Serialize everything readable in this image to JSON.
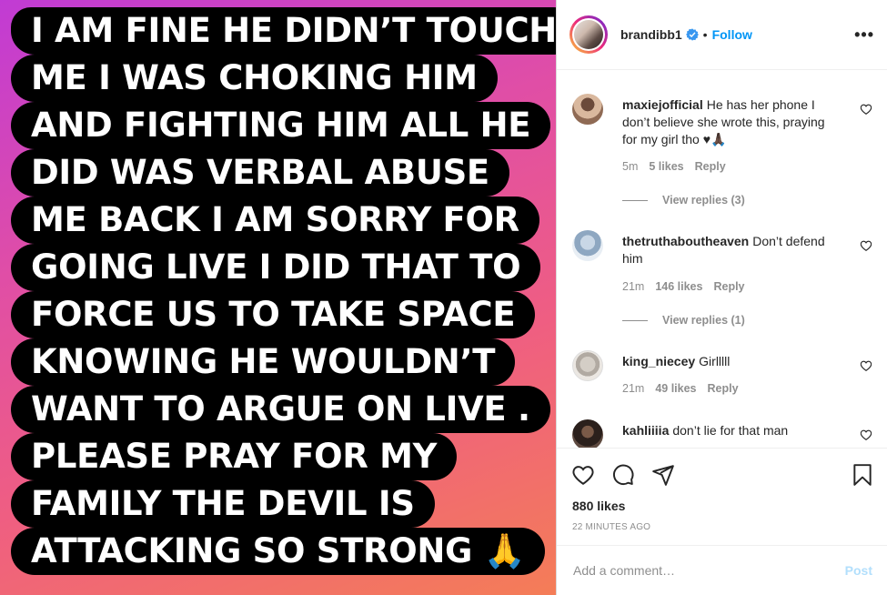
{
  "story_lines": [
    "I AM FINE HE DIDN’T TOUCH",
    "ME I WAS CHOKING HIM",
    "AND FIGHTING HIM ALL HE",
    "DID WAS VERBAL ABUSE",
    "ME BACK I AM SORRY FOR",
    "GOING LIVE I DID THAT TO",
    "FORCE US TO TAKE SPACE",
    "KNOWING HE WOULDN’T",
    "WANT TO ARGUE ON LIVE .",
    "PLEASE PRAY FOR MY",
    "FAMILY THE DEVIL IS",
    "ATTACKING SO STRONG 🙏"
  ],
  "header": {
    "username": "brandibb1",
    "dot": "•",
    "follow_label": "Follow",
    "more_label": "•••",
    "avatar_icon": "profile-avatar",
    "verified_icon": "verified-badge-icon",
    "verified_color": "#3897f0"
  },
  "comments": [
    {
      "username": "maxiejofficial",
      "text": "He has her phone I don’t believe she wrote this, praying for my girl tho ♥🙏🏿",
      "time": "5m",
      "likes": "5 likes",
      "reply_label": "Reply",
      "view_replies": "View replies (3)"
    },
    {
      "username": "thetruthaboutheaven",
      "text": "Don’t defend him",
      "time": "21m",
      "likes": "146 likes",
      "reply_label": "Reply",
      "view_replies": "View replies (1)"
    },
    {
      "username": "king_niecey",
      "text": "Girlllll",
      "time": "21m",
      "likes": "49 likes",
      "reply_label": "Reply"
    },
    {
      "username": "kahliiiia",
      "text": "don’t lie for that man"
    }
  ],
  "actions": {
    "like_icon": "heart-icon",
    "comment_icon": "comment-icon",
    "share_icon": "share-icon",
    "save_icon": "bookmark-icon",
    "likes": "880 likes",
    "time_ago": "22 MINUTES AGO"
  },
  "add_comment": {
    "placeholder": "Add a comment…",
    "post_label": "Post"
  },
  "colors": {
    "accent": "#0095f6",
    "post_disabled": "#b2dffc",
    "muted": "#8e8e8e",
    "text": "#262626"
  }
}
